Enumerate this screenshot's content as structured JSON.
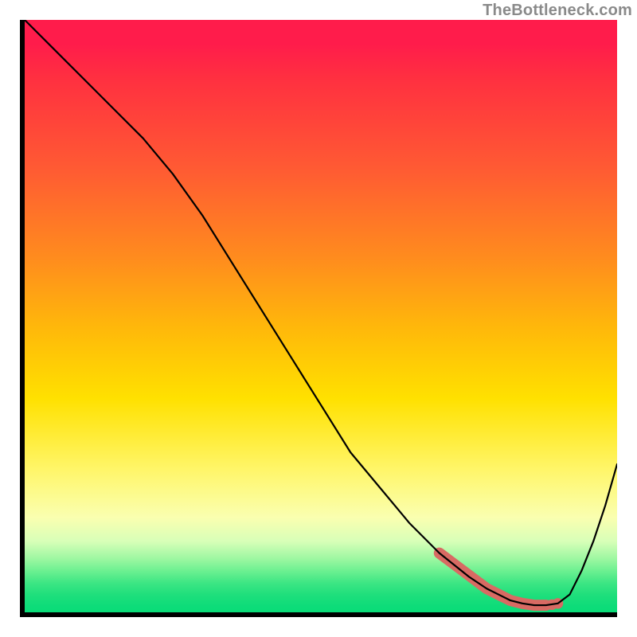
{
  "attribution": {
    "text": "TheBottleneck.com"
  },
  "colors": {
    "gradient_top": "#ff1c4b",
    "gradient_mid": "#ffe100",
    "gradient_bottom": "#0adc78",
    "curve": "#000000",
    "axis": "#000000",
    "highlight": "#d86a63",
    "attribution_text": "#8a8a8a"
  },
  "chart_data": {
    "type": "line",
    "title": "",
    "xlabel": "",
    "ylabel": "",
    "xlim": [
      0,
      100
    ],
    "ylim": [
      0,
      100
    ],
    "series": [
      {
        "name": "bottleneck-curve",
        "x": [
          0,
          5,
          10,
          15,
          20,
          25,
          30,
          35,
          40,
          45,
          50,
          55,
          60,
          65,
          70,
          75,
          78,
          80,
          82,
          84,
          86,
          88,
          90,
          92,
          94,
          96,
          98,
          100
        ],
        "y": [
          100,
          95,
          90,
          85,
          80,
          74,
          67,
          59,
          51,
          43,
          35,
          27,
          21,
          15,
          10,
          6,
          4,
          3,
          2,
          1.5,
          1.2,
          1.2,
          1.5,
          3,
          7,
          12,
          18,
          25
        ]
      }
    ],
    "highlight": {
      "name": "selected-range",
      "x": [
        70,
        74,
        78,
        80,
        82,
        84,
        86,
        88
      ],
      "y": [
        10,
        7,
        4,
        3,
        2,
        1.5,
        1.2,
        1.2
      ]
    },
    "highlight_extra_dots": {
      "x": [
        89,
        90
      ],
      "y": [
        1.3,
        1.5
      ]
    }
  }
}
